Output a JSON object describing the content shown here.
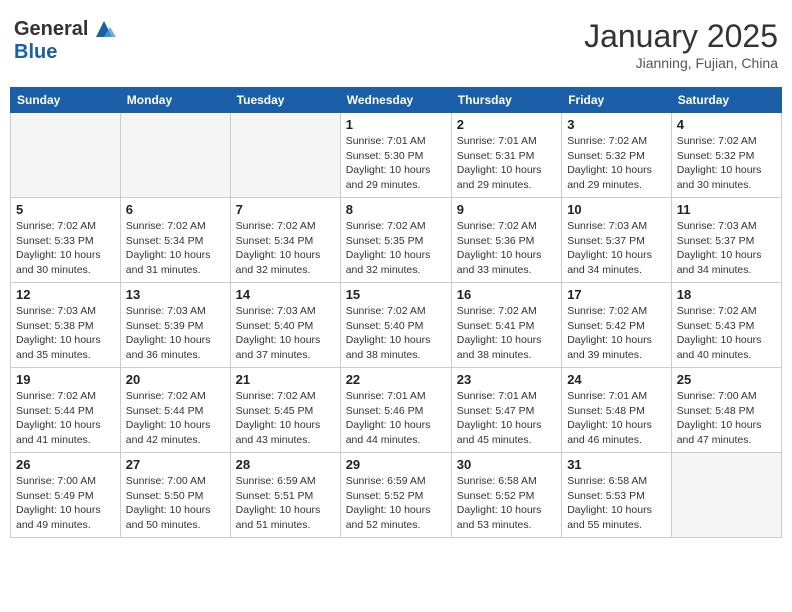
{
  "logo": {
    "general": "General",
    "blue": "Blue"
  },
  "header": {
    "month": "January 2025",
    "location": "Jianning, Fujian, China"
  },
  "weekdays": [
    "Sunday",
    "Monday",
    "Tuesday",
    "Wednesday",
    "Thursday",
    "Friday",
    "Saturday"
  ],
  "weeks": [
    [
      {
        "day": "",
        "info": ""
      },
      {
        "day": "",
        "info": ""
      },
      {
        "day": "",
        "info": ""
      },
      {
        "day": "1",
        "info": "Sunrise: 7:01 AM\nSunset: 5:30 PM\nDaylight: 10 hours and 29 minutes."
      },
      {
        "day": "2",
        "info": "Sunrise: 7:01 AM\nSunset: 5:31 PM\nDaylight: 10 hours and 29 minutes."
      },
      {
        "day": "3",
        "info": "Sunrise: 7:02 AM\nSunset: 5:32 PM\nDaylight: 10 hours and 29 minutes."
      },
      {
        "day": "4",
        "info": "Sunrise: 7:02 AM\nSunset: 5:32 PM\nDaylight: 10 hours and 30 minutes."
      }
    ],
    [
      {
        "day": "5",
        "info": "Sunrise: 7:02 AM\nSunset: 5:33 PM\nDaylight: 10 hours and 30 minutes."
      },
      {
        "day": "6",
        "info": "Sunrise: 7:02 AM\nSunset: 5:34 PM\nDaylight: 10 hours and 31 minutes."
      },
      {
        "day": "7",
        "info": "Sunrise: 7:02 AM\nSunset: 5:34 PM\nDaylight: 10 hours and 32 minutes."
      },
      {
        "day": "8",
        "info": "Sunrise: 7:02 AM\nSunset: 5:35 PM\nDaylight: 10 hours and 32 minutes."
      },
      {
        "day": "9",
        "info": "Sunrise: 7:02 AM\nSunset: 5:36 PM\nDaylight: 10 hours and 33 minutes."
      },
      {
        "day": "10",
        "info": "Sunrise: 7:03 AM\nSunset: 5:37 PM\nDaylight: 10 hours and 34 minutes."
      },
      {
        "day": "11",
        "info": "Sunrise: 7:03 AM\nSunset: 5:37 PM\nDaylight: 10 hours and 34 minutes."
      }
    ],
    [
      {
        "day": "12",
        "info": "Sunrise: 7:03 AM\nSunset: 5:38 PM\nDaylight: 10 hours and 35 minutes."
      },
      {
        "day": "13",
        "info": "Sunrise: 7:03 AM\nSunset: 5:39 PM\nDaylight: 10 hours and 36 minutes."
      },
      {
        "day": "14",
        "info": "Sunrise: 7:03 AM\nSunset: 5:40 PM\nDaylight: 10 hours and 37 minutes."
      },
      {
        "day": "15",
        "info": "Sunrise: 7:02 AM\nSunset: 5:40 PM\nDaylight: 10 hours and 38 minutes."
      },
      {
        "day": "16",
        "info": "Sunrise: 7:02 AM\nSunset: 5:41 PM\nDaylight: 10 hours and 38 minutes."
      },
      {
        "day": "17",
        "info": "Sunrise: 7:02 AM\nSunset: 5:42 PM\nDaylight: 10 hours and 39 minutes."
      },
      {
        "day": "18",
        "info": "Sunrise: 7:02 AM\nSunset: 5:43 PM\nDaylight: 10 hours and 40 minutes."
      }
    ],
    [
      {
        "day": "19",
        "info": "Sunrise: 7:02 AM\nSunset: 5:44 PM\nDaylight: 10 hours and 41 minutes."
      },
      {
        "day": "20",
        "info": "Sunrise: 7:02 AM\nSunset: 5:44 PM\nDaylight: 10 hours and 42 minutes."
      },
      {
        "day": "21",
        "info": "Sunrise: 7:02 AM\nSunset: 5:45 PM\nDaylight: 10 hours and 43 minutes."
      },
      {
        "day": "22",
        "info": "Sunrise: 7:01 AM\nSunset: 5:46 PM\nDaylight: 10 hours and 44 minutes."
      },
      {
        "day": "23",
        "info": "Sunrise: 7:01 AM\nSunset: 5:47 PM\nDaylight: 10 hours and 45 minutes."
      },
      {
        "day": "24",
        "info": "Sunrise: 7:01 AM\nSunset: 5:48 PM\nDaylight: 10 hours and 46 minutes."
      },
      {
        "day": "25",
        "info": "Sunrise: 7:00 AM\nSunset: 5:48 PM\nDaylight: 10 hours and 47 minutes."
      }
    ],
    [
      {
        "day": "26",
        "info": "Sunrise: 7:00 AM\nSunset: 5:49 PM\nDaylight: 10 hours and 49 minutes."
      },
      {
        "day": "27",
        "info": "Sunrise: 7:00 AM\nSunset: 5:50 PM\nDaylight: 10 hours and 50 minutes."
      },
      {
        "day": "28",
        "info": "Sunrise: 6:59 AM\nSunset: 5:51 PM\nDaylight: 10 hours and 51 minutes."
      },
      {
        "day": "29",
        "info": "Sunrise: 6:59 AM\nSunset: 5:52 PM\nDaylight: 10 hours and 52 minutes."
      },
      {
        "day": "30",
        "info": "Sunrise: 6:58 AM\nSunset: 5:52 PM\nDaylight: 10 hours and 53 minutes."
      },
      {
        "day": "31",
        "info": "Sunrise: 6:58 AM\nSunset: 5:53 PM\nDaylight: 10 hours and 55 minutes."
      },
      {
        "day": "",
        "info": ""
      }
    ]
  ]
}
